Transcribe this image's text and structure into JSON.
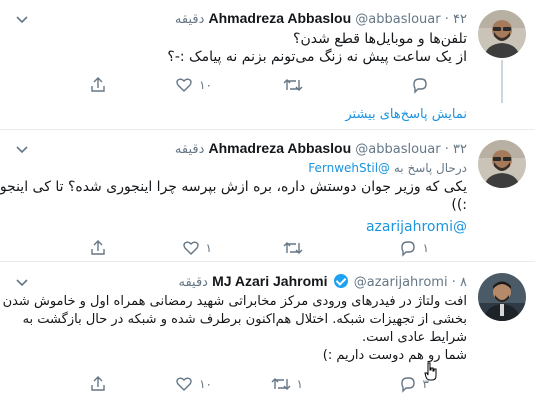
{
  "colors": {
    "link": "#1b95e0",
    "muted": "#657786",
    "verified": "#1da1f2",
    "border": "#e6ecf0"
  },
  "tweets": [
    {
      "name": "Ahmadreza Abbaslou",
      "handle": "@abbaslouar",
      "dot": "·",
      "time": "۴۲ دقیقه",
      "lines": [
        "تلفن‌ها و موبایل‌ها قطع شدن؟",
        "از یک ساعت پیش نه زنگ می‌تونم بزنم نه پیامک :-؟"
      ],
      "actions": {
        "reply_icon": "reply-icon",
        "retweet_icon": "retweet-icon",
        "like_icon": "heart-icon",
        "like_count": "۱۰",
        "share_icon": "share-icon"
      }
    },
    {
      "name": "Ahmadreza Abbaslou",
      "handle": "@abbaslouar",
      "dot": "·",
      "time": "۳۲ دقیقه",
      "replying_prefix": "درحال پاسخ به",
      "replying_to": "@FernwehStil",
      "lines": [
        "یکی که وزیر جوان دوستش داره، بره ازش بپرسه چرا اینجوری شده؟ تا کی اینجوریه؟",
        ":))"
      ],
      "mention": "@azarijahromi",
      "actions": {
        "reply_icon": "reply-icon",
        "reply_count": "۱",
        "retweet_icon": "retweet-icon",
        "like_icon": "heart-icon",
        "like_count": "۱",
        "share_icon": "share-icon"
      }
    },
    {
      "name": "MJ Azari Jahromi",
      "handle": "@azarijahromi",
      "dot": "·",
      "time": "۸ دقیقه",
      "lines": [
        "افت ولتاژ در فیدرهای ورودی مرکز مخابراتی شهید رمضانی همراه اول و خاموش شدن",
        "بخشی از تجهیزات شبکه. اختلال هم‌اکنون برطرف شده و شبکه در حال بازگشت به",
        "شرایط عادی است.",
        "شما رو هم دوست داریم :)"
      ],
      "actions": {
        "reply_icon": "reply-icon",
        "reply_count": "۳",
        "retweet_icon": "retweet-icon",
        "retweet_count": "۱",
        "like_icon": "heart-icon",
        "like_count": "۱۰",
        "share_icon": "share-icon"
      }
    }
  ],
  "more_replies": "نمایش پاسخ‌های بیشتر"
}
